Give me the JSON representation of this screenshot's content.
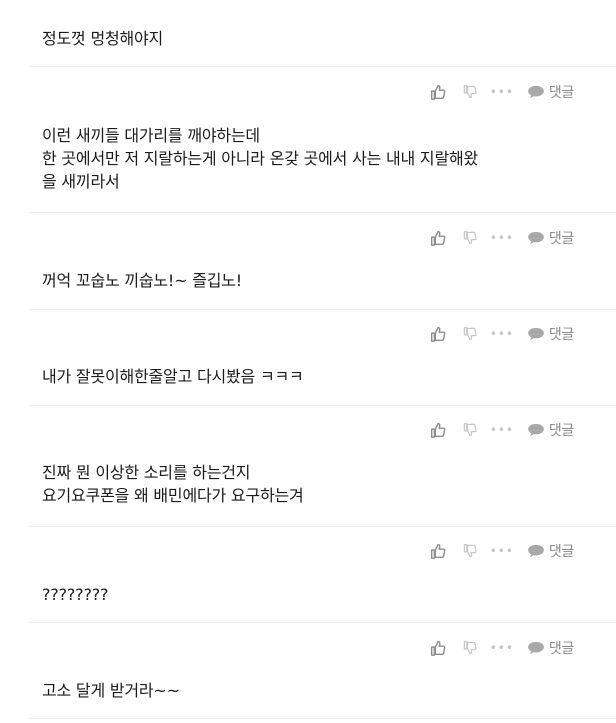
{
  "actions": {
    "like_icon": "thumbs-up-icon",
    "dislike_icon": "thumbs-down-icon",
    "more_label": "•••",
    "reply_icon": "speech-bubble-icon",
    "reply_label": "댓글"
  },
  "comments": [
    {
      "text": "정도껏 멍청해야지"
    },
    {
      "text": "이런 새끼들 대가리를 깨야하는데\n한 곳에서만 저 지랄하는게 아니라 온갖 곳에서 사는 내내 지랄해왔\n을 새끼라서"
    },
    {
      "text": "꺼억 꼬숩노 끼숩노!~ 즐깁노!"
    },
    {
      "text": "내가 잘못이해한줄알고 다시봤음 ㅋㅋㅋ"
    },
    {
      "text": "진짜 뭔 이상한 소리를 하는건지\n요기요쿠폰을 왜 배민에다가 요구하는겨"
    },
    {
      "text": "????????"
    },
    {
      "text": "고소 달게 받거라~~"
    }
  ],
  "colors": {
    "text": "#1b1b1b",
    "icon": "#9a9a9a",
    "separator": "#ececec",
    "reply_label": "#8a8a8a"
  }
}
